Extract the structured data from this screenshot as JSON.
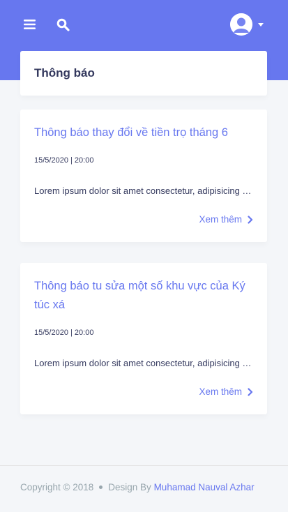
{
  "colors": {
    "primary": "#6777ef",
    "text": "#34395e",
    "muted": "#98a6ad",
    "background": "#f4f6f9"
  },
  "navbar": {
    "menu_icon": "hamburger-menu-icon",
    "search_icon": "search-icon",
    "avatar_icon": "user-avatar-icon",
    "dropdown_icon": "caret-down-icon"
  },
  "page": {
    "title": "Thông báo"
  },
  "notifications": [
    {
      "title": "Thông báo thay đổi về tiền trọ tháng 6",
      "date": "15/5/2020 | 20:00",
      "excerpt": "Lorem ipsum dolor sit amet consectetur, adipisicing elit.",
      "more_label": "Xem thêm"
    },
    {
      "title": "Thông báo tu sửa một số khu vực của Ký túc xá",
      "date": "15/5/2020 | 20:00",
      "excerpt": "Lorem ipsum dolor sit amet consectetur, adipisicing elit.",
      "more_label": "Xem thêm"
    }
  ],
  "footer": {
    "copyright": "Copyright © 2018",
    "design_by": "Design By",
    "author": "Muhamad Nauval Azhar"
  }
}
